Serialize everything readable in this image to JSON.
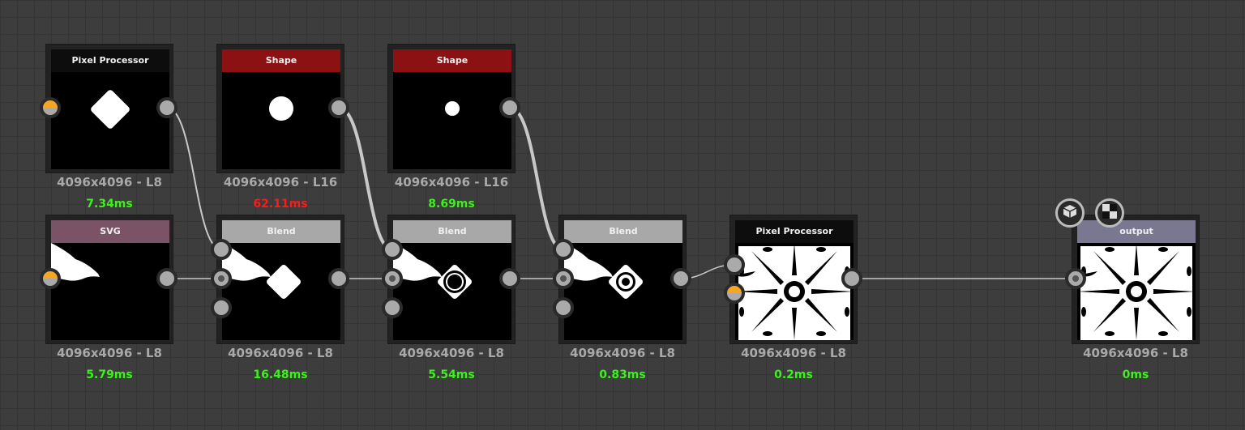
{
  "colors": {
    "timing_ok": "#3cf21c",
    "timing_slow": "#ff1a1a",
    "header_shape": "#8b1113",
    "header_blend": "#a8a8a8",
    "header_svg": "#7a5466",
    "header_pixel": "#0d0d0d",
    "header_output": "#7a7890",
    "port_orange": "#f5a623"
  },
  "nodes": [
    {
      "id": "pp1",
      "title": "Pixel Processor",
      "header": "header_pixel",
      "preview": "diamond",
      "resolution": "4096x4096 - L8",
      "timing": "7.34ms",
      "slow": false
    },
    {
      "id": "shape1",
      "title": "Shape",
      "header": "header_shape",
      "preview": "circle-big",
      "resolution": "4096x4096 - L16",
      "timing": "62.11ms",
      "slow": true
    },
    {
      "id": "shape2",
      "title": "Shape",
      "header": "header_shape",
      "preview": "circle-small",
      "resolution": "4096x4096 - L16",
      "timing": "8.69ms",
      "slow": false
    },
    {
      "id": "svg",
      "title": "SVG",
      "header": "header_svg",
      "preview": "leaf",
      "resolution": "4096x4096 - L8",
      "timing": "5.79ms",
      "slow": false
    },
    {
      "id": "blend1",
      "title": "Blend",
      "header": "header_blend",
      "preview": "blend1",
      "resolution": "4096x4096 - L8",
      "timing": "16.48ms",
      "slow": false
    },
    {
      "id": "blend2",
      "title": "Blend",
      "header": "header_blend",
      "preview": "blend2",
      "resolution": "4096x4096 - L8",
      "timing": "5.54ms",
      "slow": false
    },
    {
      "id": "blend3",
      "title": "Blend",
      "header": "header_blend",
      "preview": "blend3",
      "resolution": "4096x4096 - L8",
      "timing": "0.83ms",
      "slow": false
    },
    {
      "id": "pp2",
      "title": "Pixel Processor",
      "header": "header_pixel",
      "preview": "ornament",
      "resolution": "4096x4096 - L8",
      "timing": "0.2ms",
      "slow": false
    },
    {
      "id": "output",
      "title": "output",
      "header": "header_output",
      "preview": "ornament",
      "resolution": "4096x4096 - L8",
      "timing": "0ms",
      "slow": false
    }
  ],
  "output_buttons": [
    {
      "icon": "3d-cube-icon"
    },
    {
      "icon": "2d-checker-icon"
    }
  ]
}
